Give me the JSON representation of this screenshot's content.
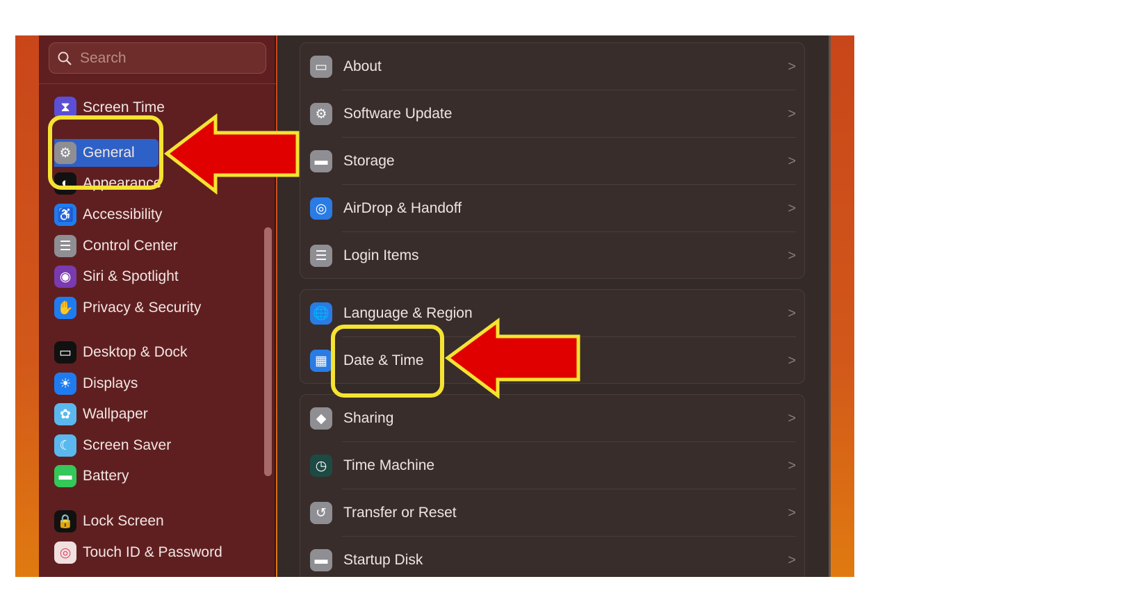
{
  "sidebar": {
    "search_placeholder": "Search",
    "items": [
      {
        "label": "Screen Time",
        "icon": "hourglass-icon",
        "color": "#5b4fd6"
      },
      {
        "label": "General",
        "icon": "gear-icon",
        "color": "#8e8e93",
        "selected": true
      },
      {
        "label": "Appearance",
        "icon": "appearance-icon",
        "color": "#111111"
      },
      {
        "label": "Accessibility",
        "icon": "accessibility-icon",
        "color": "#1f7cf0"
      },
      {
        "label": "Control Center",
        "icon": "toggles-icon",
        "color": "#8e8e93"
      },
      {
        "label": "Siri & Spotlight",
        "icon": "siri-icon",
        "color": "#7a3ab0"
      },
      {
        "label": "Privacy & Security",
        "icon": "hand-icon",
        "color": "#1f7cf0"
      },
      {
        "label": "Desktop & Dock",
        "icon": "dock-icon",
        "color": "#111111"
      },
      {
        "label": "Displays",
        "icon": "sun-icon",
        "color": "#1f7cf0"
      },
      {
        "label": "Wallpaper",
        "icon": "flower-icon",
        "color": "#5ab8ee"
      },
      {
        "label": "Screen Saver",
        "icon": "screensaver-icon",
        "color": "#5ab8ee"
      },
      {
        "label": "Battery",
        "icon": "battery-icon",
        "color": "#34c759"
      },
      {
        "label": "Lock Screen",
        "icon": "lock-icon",
        "color": "#111111"
      },
      {
        "label": "Touch ID & Password",
        "icon": "fingerprint-icon",
        "color": "#f0e0e0"
      }
    ]
  },
  "main": {
    "groups": [
      [
        {
          "label": "About",
          "icon": "laptop-icon"
        },
        {
          "label": "Software Update",
          "icon": "gear-update-icon"
        },
        {
          "label": "Storage",
          "icon": "drive-icon"
        },
        {
          "label": "AirDrop & Handoff",
          "icon": "airdrop-icon"
        },
        {
          "label": "Login Items",
          "icon": "list-icon"
        }
      ],
      [
        {
          "label": "Language & Region",
          "icon": "globe-icon"
        },
        {
          "label": "Date & Time",
          "icon": "calendar-clock-icon"
        }
      ],
      [
        {
          "label": "Sharing",
          "icon": "sharing-icon"
        },
        {
          "label": "Time Machine",
          "icon": "time-machine-icon"
        },
        {
          "label": "Transfer or Reset",
          "icon": "reset-icon"
        },
        {
          "label": "Startup Disk",
          "icon": "disk-icon"
        }
      ]
    ]
  },
  "annotations": {
    "arrow_color": "#e00000",
    "outline_color": "#f5e332"
  }
}
